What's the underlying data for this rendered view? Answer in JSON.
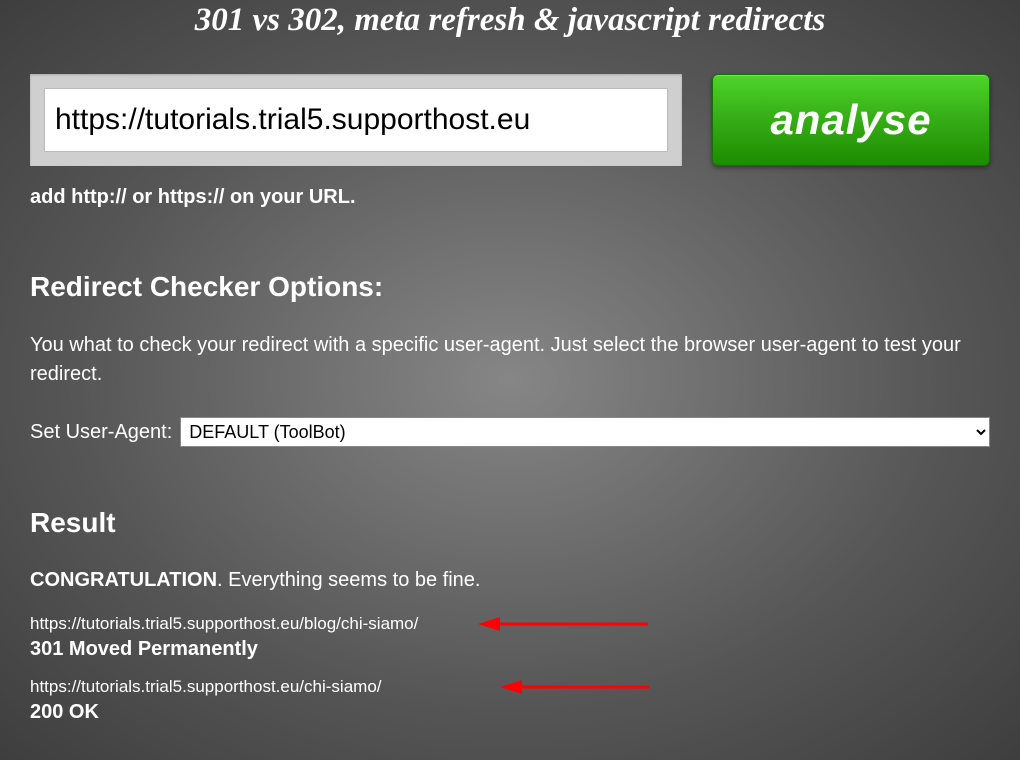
{
  "page": {
    "title": "301 vs 302, meta refresh & javascript redirects"
  },
  "search": {
    "input_value": "https://tutorials.trial5.supporthost.eu",
    "analyse_label": "analyse",
    "hint": "add http:// or https:// on your URL."
  },
  "options": {
    "heading": "Redirect Checker Options:",
    "description": "You what to check your redirect with a specific user-agent. Just select the browser user-agent to test your redirect.",
    "ua_label": "Set User-Agent:",
    "ua_selected": "DEFAULT (ToolBot)"
  },
  "result": {
    "heading": "Result",
    "congrats_bold": "CONGRATULATION",
    "congrats_rest": ". Everything seems to be fine.",
    "items": [
      {
        "url": "https://tutorials.trial5.supporthost.eu/blog/chi-siamo/",
        "status": "301 Moved Permanently"
      },
      {
        "url": "https://tutorials.trial5.supporthost.eu/chi-siamo/",
        "status": "200 OK"
      }
    ]
  },
  "colors": {
    "arrow": "#ff0000"
  }
}
